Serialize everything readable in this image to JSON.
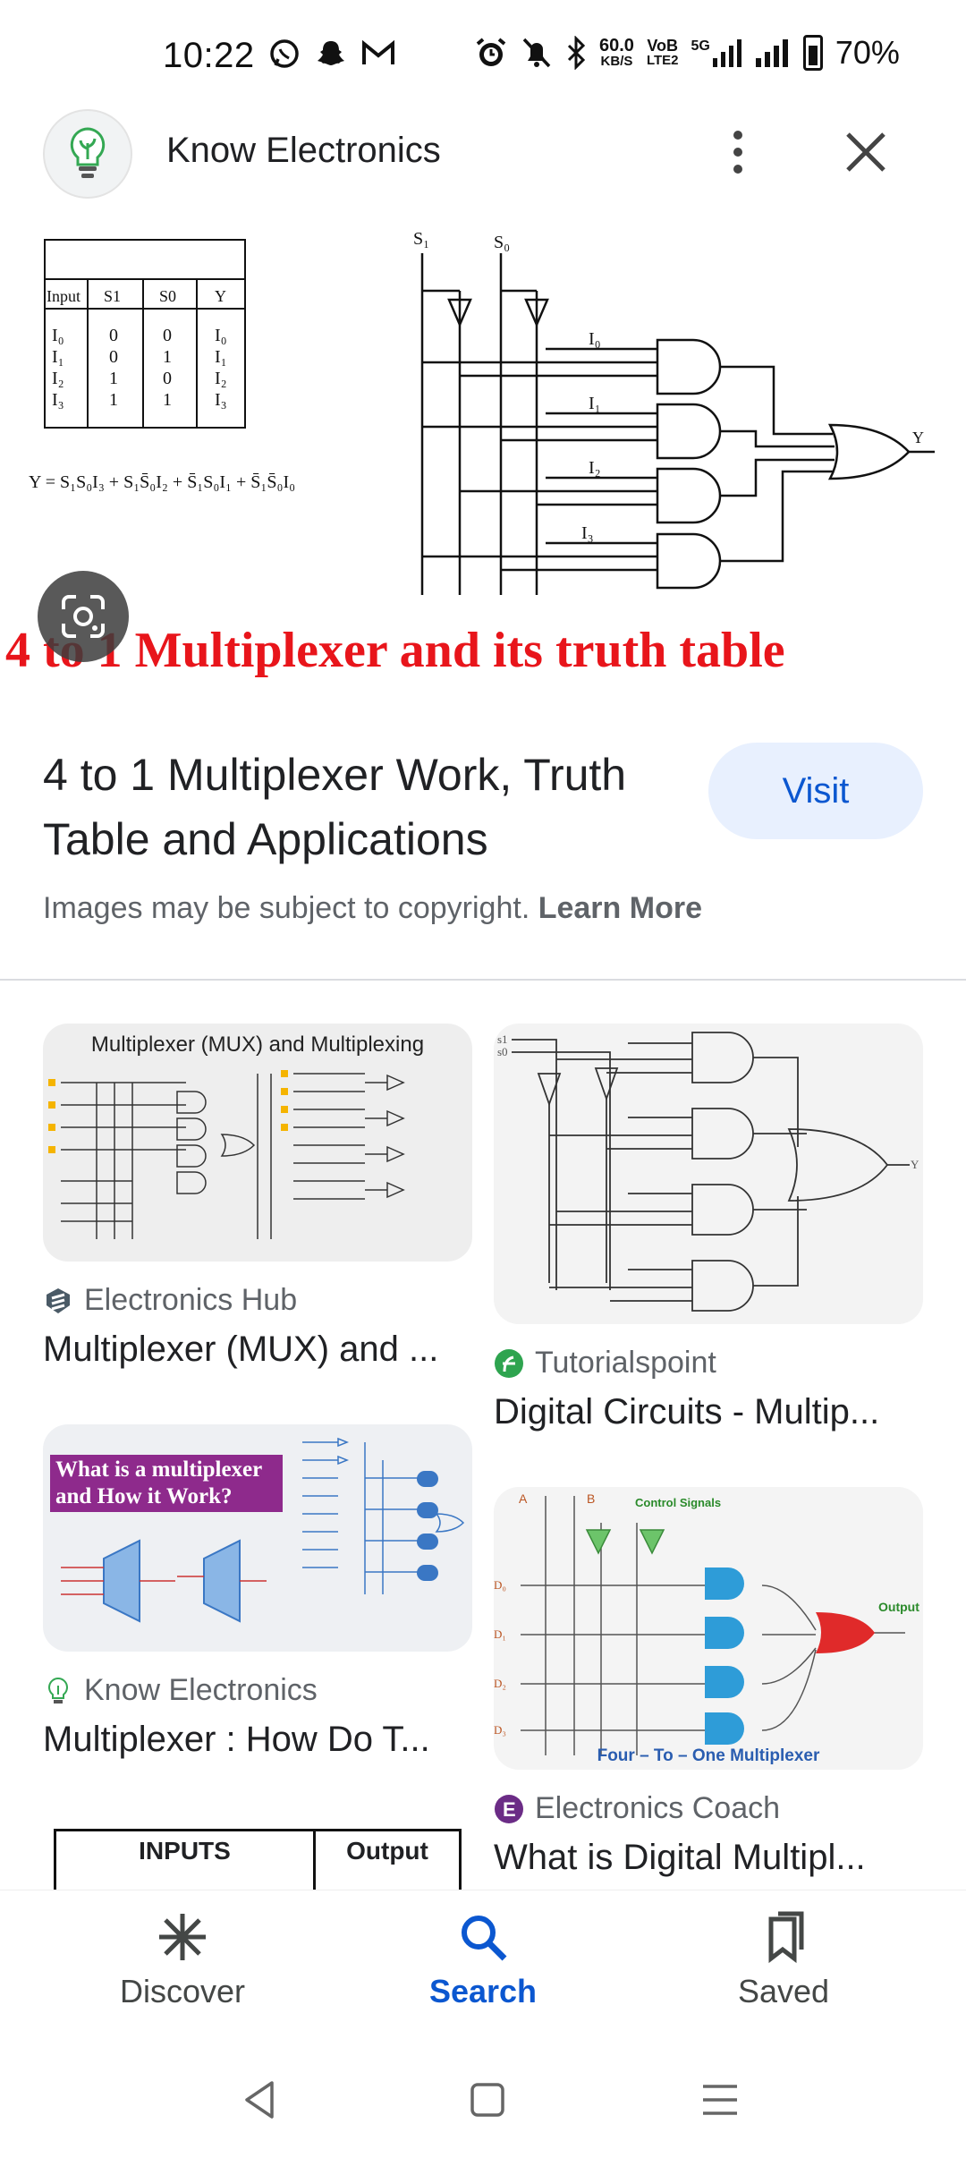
{
  "status_bar": {
    "time": "10:22",
    "net_speed_value": "60.0",
    "net_speed_unit": "KB/S",
    "volte_top": "VoB",
    "volte_bottom": "LTE2",
    "network": "5G",
    "battery": "70%"
  },
  "header": {
    "site_name": "Know Electronics"
  },
  "hero": {
    "caption": "4 to 1 Multiplexer and its truth table",
    "table_headers": [
      "Input",
      "S1",
      "S0",
      "Y"
    ],
    "table_inputs": "I0 I1 I2 I3",
    "equation": "Y = S1S0I3 + S1S0I2 + S1S0I1 + S1S0I0",
    "diagram_labels": [
      "S1",
      "S0",
      "I0",
      "I1",
      "I2",
      "I3",
      "Y"
    ]
  },
  "result": {
    "title": "4 to 1 Multiplexer Work, Truth Table and Applications",
    "visit_label": "Visit",
    "copyright_text": "Images may be subject to copyright.",
    "learn_more": "Learn More"
  },
  "grid": [
    {
      "source": "Electronics Hub",
      "title": "Multiplexer (MUX) and ...",
      "image_title": "Multiplexer (MUX) and Multiplexing"
    },
    {
      "source": "Tutorialspoint",
      "title": "Digital Circuits - Multip..."
    },
    {
      "source": "Know Electronics",
      "title": "Multiplexer : How Do T...",
      "image_title": "What is a multiplexer and How it Work?"
    },
    {
      "source": "Electronics Coach",
      "title": "What is Digital Multipl...",
      "image_title": "Four – To – One Multiplexer",
      "image_sub": "Control Signals",
      "image_output": "Output"
    },
    {
      "table_header_1": "INPUTS",
      "table_header_2": "Output"
    }
  ],
  "bottom_nav": {
    "discover": "Discover",
    "search": "Search",
    "saved": "Saved"
  }
}
